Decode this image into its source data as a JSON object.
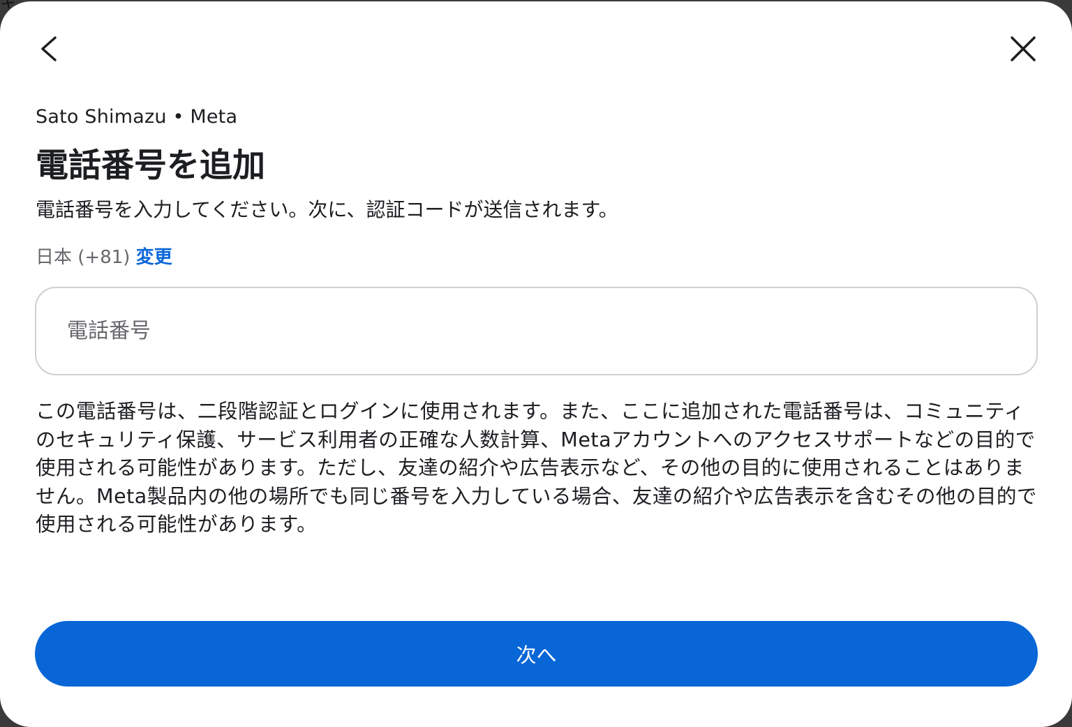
{
  "backdrop": {
    "partial_text": "キ"
  },
  "dialog": {
    "back_icon": "chevron-left-icon",
    "close_icon": "close-icon",
    "account_line": "Sato Shimazu • Meta",
    "title": "電話番号を追加",
    "subtitle": "電話番号を入力してください。次に、認証コードが送信されます。",
    "country": {
      "label": "日本 (+81)",
      "change_link": "変更"
    },
    "phone_input": {
      "placeholder": "電話番号",
      "value": ""
    },
    "disclaimer": "この電話番号は、二段階認証とログインに使用されます。また、ここに追加された電話番号は、コミュニティのセキュリティ保護、サービス利用者の正確な人数計算、Metaアカウントへのアクセスサポートなどの目的で使用される可能性があります。ただし、友達の紹介や広告表示など、その他の目的に使用されることはありません。Meta製品内の他の場所でも同じ番号を入力している場合、友達の紹介や広告表示を含むその他の目的で使用される可能性があります。",
    "next_button": "次へ"
  },
  "colors": {
    "primary": "#0866d6",
    "link": "#0a66d8",
    "text": "#1c1e21",
    "secondary_text": "#65676b",
    "input_border": "#ccd0d5"
  }
}
